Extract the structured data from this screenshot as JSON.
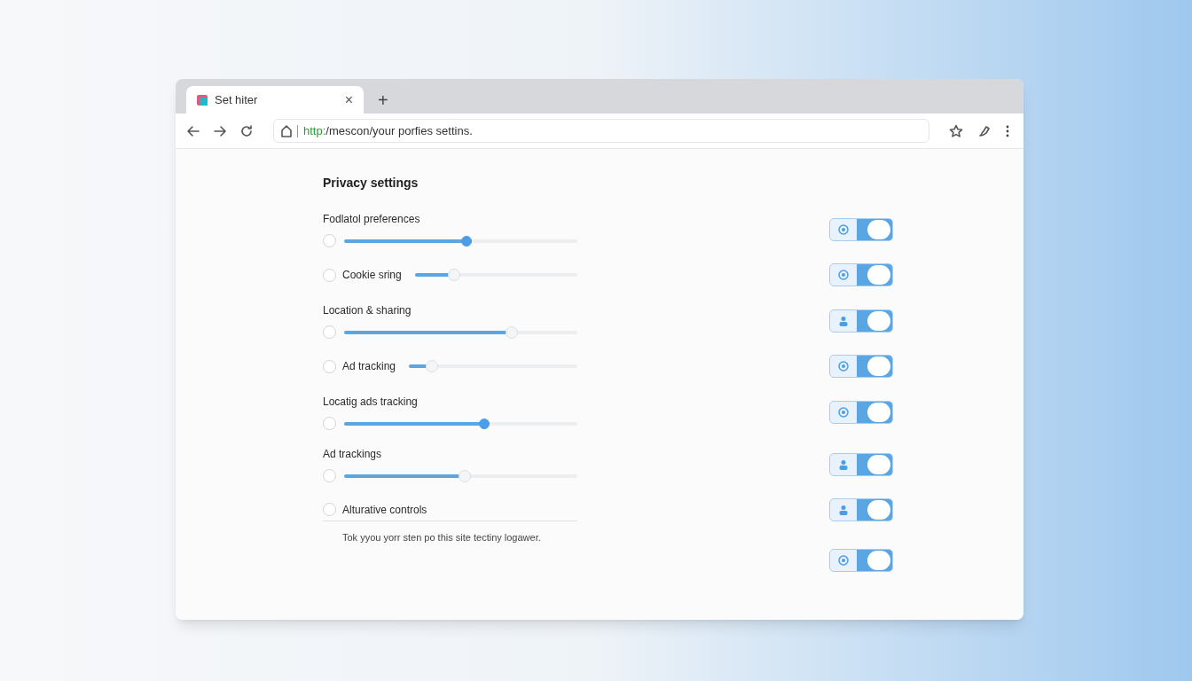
{
  "tabs": [
    {
      "title": "Set hiter",
      "selected": true,
      "close": "×"
    }
  ],
  "new_tab": "+",
  "address_bar": {
    "scheme": "http:",
    "rest": "/mescon/your porfies settins."
  },
  "page": {
    "title": "Privacy settings",
    "settings": [
      {
        "kind": "stacked",
        "label": "Fodlatol preferences",
        "checked": false,
        "level": 0.53,
        "thumb_active": true,
        "toggle_on": true
      },
      {
        "kind": "inline",
        "label": "Cookie sring",
        "checked": false,
        "level": 0.22,
        "thumb_active": false,
        "toggle_on": true
      },
      {
        "kind": "stacked",
        "label": "Location & sharing",
        "checked": false,
        "level": 0.73,
        "thumb_active": false,
        "toggle_on": true
      },
      {
        "kind": "inline",
        "label": "Ad tracking",
        "checked": false,
        "level": 0.11,
        "thumb_active": false,
        "toggle_on": true
      },
      {
        "kind": "stacked",
        "label": "Locatig ads tracking",
        "checked": false,
        "level": 0.61,
        "thumb_active": true,
        "toggle_on": true
      },
      {
        "kind": "stacked",
        "label": "Ad trackings",
        "checked": false,
        "level": 0.52,
        "thumb_active": false,
        "toggle_on": true
      },
      {
        "kind": "plain",
        "label": "Alturative controls",
        "checked": false,
        "toggle_on": true
      }
    ],
    "description": "Tok yyou yorr sten po this site tectiny logawer.",
    "description_toggle_on": true
  }
}
